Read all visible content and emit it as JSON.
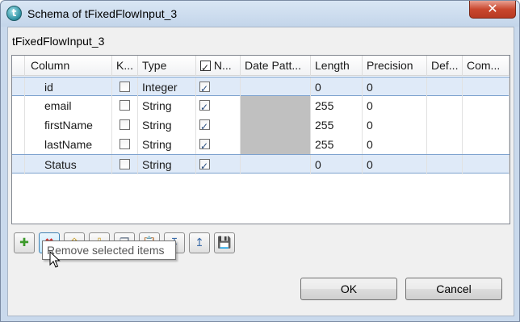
{
  "window": {
    "title": "Schema of tFixedFlowInput_3",
    "close_glyph": "✕",
    "app_icon_glyph": "t"
  },
  "group": {
    "label": "tFixedFlowInput_3"
  },
  "table": {
    "columns": [
      "Column",
      "K...",
      "Type",
      "N...",
      "Date Patt...",
      "Length",
      "Precision",
      "Def...",
      "Com..."
    ],
    "rows": [
      {
        "column": "id",
        "key": false,
        "type": "Integer",
        "nullable": true,
        "date_pattern": "",
        "date_pattern_disabled": false,
        "length": "0",
        "precision": "0",
        "default": "",
        "comment": "",
        "selected": true
      },
      {
        "column": "email",
        "key": false,
        "type": "String",
        "nullable": true,
        "date_pattern": "",
        "date_pattern_disabled": true,
        "length": "255",
        "precision": "0",
        "default": "",
        "comment": "",
        "selected": false
      },
      {
        "column": "firstName",
        "key": false,
        "type": "String",
        "nullable": true,
        "date_pattern": "",
        "date_pattern_disabled": true,
        "length": "255",
        "precision": "0",
        "default": "",
        "comment": "",
        "selected": false
      },
      {
        "column": "lastName",
        "key": false,
        "type": "String",
        "nullable": true,
        "date_pattern": "",
        "date_pattern_disabled": true,
        "length": "255",
        "precision": "0",
        "default": "",
        "comment": "",
        "selected": false
      },
      {
        "column": "Status",
        "key": false,
        "type": "String",
        "nullable": true,
        "date_pattern": "",
        "date_pattern_disabled": false,
        "length": "0",
        "precision": "0",
        "default": "",
        "comment": "",
        "selected": true
      }
    ]
  },
  "toolbar": {
    "buttons": [
      {
        "name": "add-icon",
        "glyph": "✚",
        "color": "#3c9a2a"
      },
      {
        "name": "remove-icon",
        "glyph": "✖",
        "color": "#d0302a"
      },
      {
        "name": "move-up-icon",
        "glyph": "⇧",
        "color": "#c89a1c"
      },
      {
        "name": "move-down-icon",
        "glyph": "⇩",
        "color": "#c89a1c"
      },
      {
        "name": "copy-icon",
        "glyph": "❐",
        "color": "#5a6a80"
      },
      {
        "name": "paste-icon",
        "glyph": "📋",
        "color": "#a0a0a0"
      },
      {
        "name": "import-icon",
        "glyph": "↧",
        "color": "#3a6aa8"
      },
      {
        "name": "export-icon",
        "glyph": "↥",
        "color": "#3a6aa8"
      },
      {
        "name": "save-icon",
        "glyph": "💾",
        "color": "#3a4a9a"
      }
    ],
    "tooltip": "Remove selected items"
  },
  "buttons": {
    "ok": "OK",
    "cancel": "Cancel"
  },
  "colors": {
    "titlebar": "#c9d9ec",
    "selection": "#dfeaf8",
    "close": "#c9472e"
  }
}
